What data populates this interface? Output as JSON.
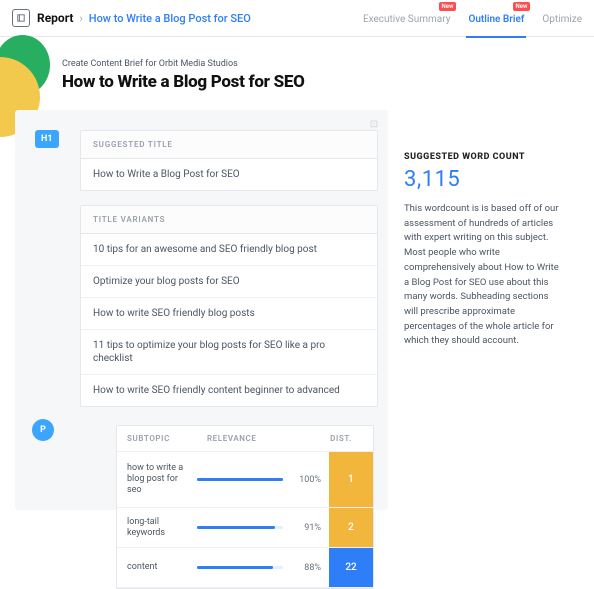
{
  "breadcrumb": {
    "root": "Report",
    "title": "How to Write a Blog Post for SEO"
  },
  "topnav": {
    "exec": "Executive Summary",
    "brief": "Outline Brief",
    "optimize": "Optimize",
    "new_badge": "New"
  },
  "pretitle": "Create Content Brief for Orbit Media Studios",
  "maintitle": "How to Write a Blog Post for SEO",
  "h1_badge": "H1",
  "p_badge": "P",
  "suggested_title": {
    "header": "SUGGESTED TITLE",
    "value": "How to Write a Blog Post for SEO"
  },
  "title_variants": {
    "header": "TITLE VARIANTS",
    "items": [
      "10 tips for an awesome and SEO friendly blog post",
      "Optimize your blog posts for SEO",
      "How to write SEO friendly blog posts",
      "11 tips to optimize your blog posts for SEO like a pro checklist",
      "How to write SEO friendly content beginner to advanced"
    ]
  },
  "subtopics": {
    "headers": {
      "c1": "SUBTOPIC",
      "c2": "RELEVANCE",
      "c3": "DIST."
    },
    "rows": [
      {
        "topic": "how to write a blog post for seo",
        "relevance": "100%",
        "bar": 100,
        "dist": "1",
        "distClass": "y tall"
      },
      {
        "topic": "long-tail keywords",
        "relevance": "91%",
        "bar": 91,
        "dist": "2",
        "distClass": "y"
      },
      {
        "topic": "content",
        "relevance": "88%",
        "bar": 88,
        "dist": "22",
        "distClass": "b"
      }
    ]
  },
  "right": {
    "label": "SUGGESTED WORD COUNT",
    "value": "3,115",
    "desc": "This wordcount is is based off of our assessment of hundreds of articles with expert writing on this subject. Most people who write comprehensively about How to Write a Blog Post for SEO use about this many words. Subheading sections will prescribe approximate percentages of the whole article for which they should account."
  }
}
